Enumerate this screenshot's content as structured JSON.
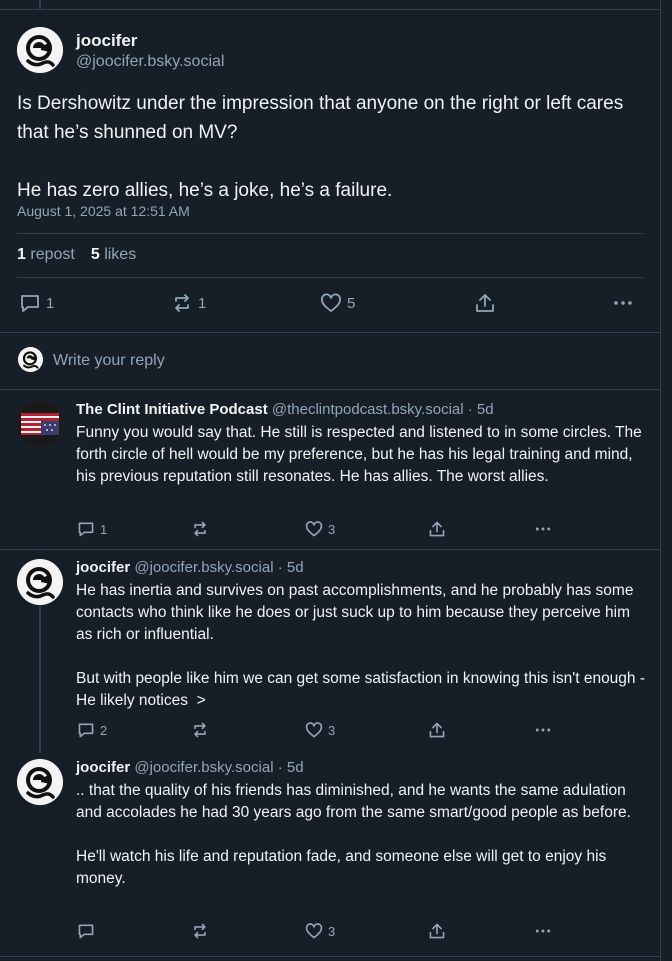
{
  "main_post": {
    "display_name": "joocifer",
    "handle": "@joocifer.bsky.social",
    "text": "Is Dershowitz under the impression that anyone on the right or left cares that he’s shunned on MV?\n\nHe has zero allies, he’s a joke, he’s a failure.",
    "timestamp": "August 1, 2025 at 12:51 AM",
    "repost_count": "1",
    "repost_label": "repost",
    "like_count": "5",
    "like_label": "likes",
    "actions": {
      "reply_count": "1",
      "repost_count": "1",
      "like_count": "5"
    }
  },
  "reply_box": {
    "placeholder": "Write your reply"
  },
  "replies": [
    {
      "display_name": "The Clint Initiative Podcast",
      "handle": "@theclintpodcast.bsky.social",
      "age": "· 5d",
      "text": "Funny you would say that. He still is respected and listened to in some circles. The forth circle of hell would be my preference, but he has his legal training and mind, his previous reputation still resonates. He has allies. The worst allies.",
      "reply_count": "1",
      "like_count": "3"
    },
    {
      "display_name": "joocifer",
      "handle": "@joocifer.bsky.social",
      "age": "· 5d",
      "text": "He has inertia and survives on past accomplishments, and he probably has some contacts who think like he does or just suck up to him because they perceive him as rich or influential.\n\nBut with people like him we can get some satisfaction in knowing this isn't enough - He likely notices  >",
      "reply_count": "2",
      "like_count": "3"
    },
    {
      "display_name": "joocifer",
      "handle": "@joocifer.bsky.social",
      "age": "· 5d",
      "text": ".. that the quality of his friends has diminished, and he wants the same adulation and accolades he had 30 years ago from the same smart/good people as before.\n\nHe'll watch his life and reputation fade, and someone else will get to enjoy his money.",
      "reply_count": "",
      "like_count": "3"
    }
  ],
  "colors": {
    "background": "#161e27",
    "border": "#2e4052",
    "text": "#f1f3f5",
    "muted": "#93a5b7"
  },
  "icons": [
    "joocifer-avatar",
    "flag-avatar",
    "reply-icon",
    "repost-icon",
    "like-icon",
    "share-icon",
    "more-icon"
  ]
}
